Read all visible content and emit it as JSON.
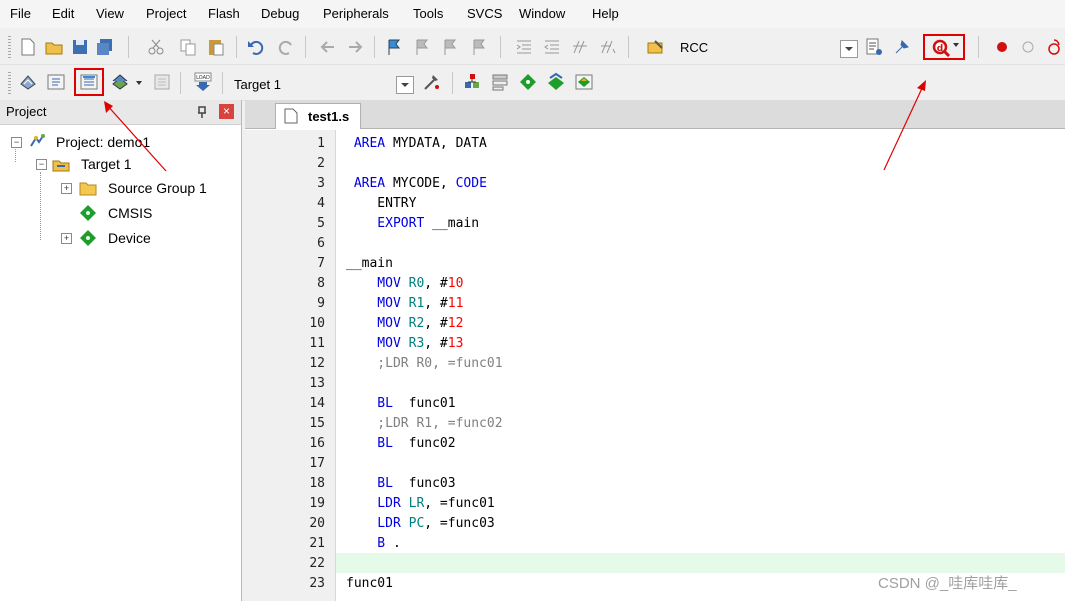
{
  "menu": [
    "File",
    "Edit",
    "View",
    "Project",
    "Flash",
    "Debug",
    "Peripherals",
    "Tools",
    "SVCS",
    "Window",
    "Help"
  ],
  "toolbar1": {
    "rcc_label": "RCC"
  },
  "toolbar2": {
    "target_label": "Target 1"
  },
  "project_panel": {
    "title": "Project",
    "pin_glyph": " ",
    "close_glyph": "×",
    "tree": [
      {
        "label": "Project: demo1",
        "expander": "−",
        "icon": "project-icon"
      },
      {
        "label": "Target 1",
        "expander": "−",
        "icon": "target-icon"
      },
      {
        "label": "Source Group 1",
        "expander": "+",
        "icon": "folder-icon"
      },
      {
        "label": "CMSIS",
        "expander": "",
        "icon": "green-diamond-icon"
      },
      {
        "label": "Device",
        "expander": "+",
        "icon": "green-diamond-icon"
      }
    ]
  },
  "editor": {
    "tab_title": "test1.s",
    "lines": [
      {
        "n": "1",
        "code": [
          [
            "kw",
            " AREA"
          ],
          [
            "plain",
            " MYDATA, DATA"
          ]
        ]
      },
      {
        "n": "2",
        "code": []
      },
      {
        "n": "3",
        "code": [
          [
            "kw",
            " AREA"
          ],
          [
            "plain",
            " MYCODE, "
          ],
          [
            "kw",
            "CODE"
          ]
        ]
      },
      {
        "n": "4",
        "code": [
          [
            "plain",
            "    ENTRY"
          ]
        ]
      },
      {
        "n": "5",
        "code": [
          [
            "kw",
            "    EXPORT"
          ],
          [
            "plain",
            " __main"
          ]
        ]
      },
      {
        "n": "6",
        "code": []
      },
      {
        "n": "7",
        "code": [
          [
            "plain",
            "__main"
          ]
        ]
      },
      {
        "n": "8",
        "code": [
          [
            "kw",
            "    MOV"
          ],
          [
            "plain",
            " "
          ],
          [
            "reg",
            "R0"
          ],
          [
            "plain",
            ", #"
          ],
          [
            "num",
            "10"
          ]
        ]
      },
      {
        "n": "9",
        "code": [
          [
            "kw",
            "    MOV"
          ],
          [
            "plain",
            " "
          ],
          [
            "reg",
            "R1"
          ],
          [
            "plain",
            ", #"
          ],
          [
            "num",
            "11"
          ]
        ]
      },
      {
        "n": "10",
        "code": [
          [
            "kw",
            "    MOV"
          ],
          [
            "plain",
            " "
          ],
          [
            "reg",
            "R2"
          ],
          [
            "plain",
            ", #"
          ],
          [
            "num",
            "12"
          ]
        ]
      },
      {
        "n": "11",
        "code": [
          [
            "kw",
            "    MOV"
          ],
          [
            "plain",
            " "
          ],
          [
            "reg",
            "R3"
          ],
          [
            "plain",
            ", #"
          ],
          [
            "num",
            "13"
          ]
        ]
      },
      {
        "n": "12",
        "code": [
          [
            "cmt",
            "    ;LDR R0, =func01"
          ]
        ]
      },
      {
        "n": "13",
        "code": []
      },
      {
        "n": "14",
        "code": [
          [
            "kw",
            "    BL"
          ],
          [
            "plain",
            "  func01"
          ]
        ]
      },
      {
        "n": "15",
        "code": [
          [
            "cmt",
            "    ;LDR R1, =func02"
          ]
        ]
      },
      {
        "n": "16",
        "code": [
          [
            "kw",
            "    BL"
          ],
          [
            "plain",
            "  func02"
          ]
        ]
      },
      {
        "n": "17",
        "code": []
      },
      {
        "n": "18",
        "code": [
          [
            "kw",
            "    BL"
          ],
          [
            "plain",
            "  func03"
          ]
        ]
      },
      {
        "n": "19",
        "code": [
          [
            "kw",
            "    LDR"
          ],
          [
            "plain",
            " "
          ],
          [
            "reg",
            "LR"
          ],
          [
            "plain",
            ", =func01"
          ]
        ]
      },
      {
        "n": "20",
        "code": [
          [
            "kw",
            "    LDR"
          ],
          [
            "plain",
            " "
          ],
          [
            "reg",
            "PC"
          ],
          [
            "plain",
            ", =func03"
          ]
        ]
      },
      {
        "n": "21",
        "code": [
          [
            "kw",
            "    B"
          ],
          [
            "plain",
            " ."
          ]
        ]
      },
      {
        "n": "22",
        "code": [],
        "highlight": true
      },
      {
        "n": "23",
        "code": [
          [
            "plain",
            "func01"
          ]
        ]
      }
    ]
  },
  "watermark": "CSDN @_哇库哇库_",
  "colors": {
    "current_line": "#e6fae9",
    "annotation": "#e00000",
    "keyword": "#0000e0",
    "register": "#008080",
    "number": "#ff0000",
    "comment": "#808080"
  }
}
